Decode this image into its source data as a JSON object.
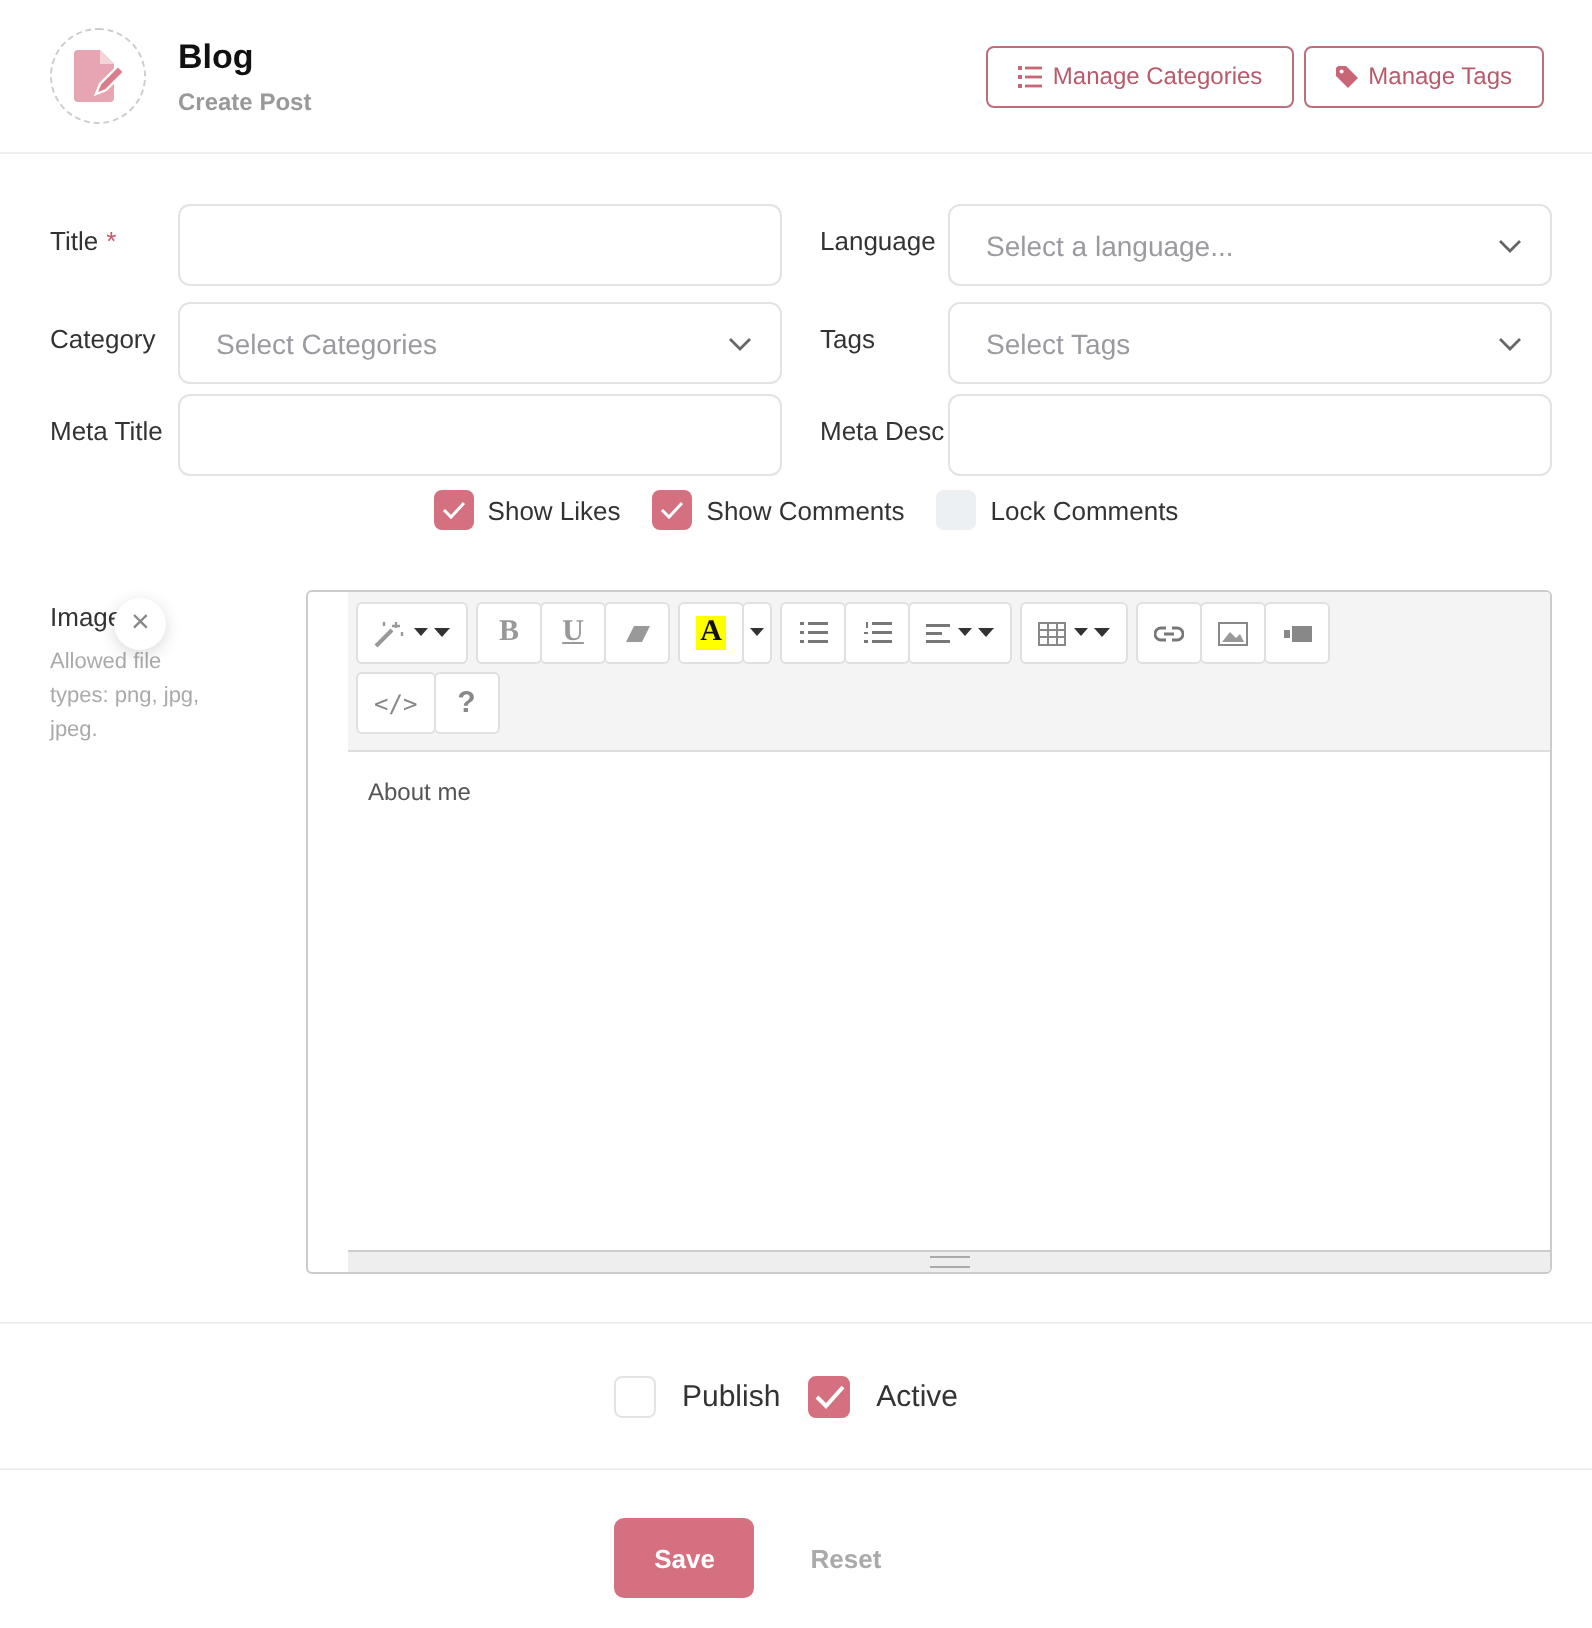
{
  "header": {
    "title": "Blog",
    "subtitle": "Create Post",
    "buttons": [
      {
        "kind": "list",
        "label": "Manage Categories"
      },
      {
        "kind": "tag",
        "label": "Manage Tags"
      }
    ]
  },
  "fields": [
    {
      "label": "Title",
      "required_mark": "*",
      "kind": "text"
    },
    {
      "label": "Language",
      "kind": "select",
      "placeholder": "Select a language..."
    },
    {
      "label": "Category",
      "kind": "select",
      "placeholder": "Select Categories"
    },
    {
      "label": "Tags",
      "kind": "select",
      "placeholder": "Select Tags"
    },
    {
      "label": "Meta Title",
      "kind": "text"
    },
    {
      "label": "Meta Desc",
      "kind": "text"
    }
  ],
  "options": [
    {
      "label": "Show Likes",
      "checked": true
    },
    {
      "label": "Show Comments",
      "checked": true
    },
    {
      "label": "Lock Comments",
      "checked": false
    }
  ],
  "image": {
    "label": "Image",
    "close": "×",
    "hint": "Allowed file types: png, jpg, jpeg."
  },
  "editor": {
    "toolbar": [
      [
        [
          {
            "kind": "magic",
            "caret": true
          }
        ],
        [
          {
            "kind": "bold",
            "label": "B"
          },
          {
            "kind": "underline",
            "label": "U"
          },
          {
            "kind": "eraser"
          }
        ],
        [
          {
            "kind": "color",
            "label": "A",
            "caret": false
          },
          {
            "kind": "more",
            "caret": true
          }
        ],
        [
          {
            "kind": "ul"
          },
          {
            "kind": "ol"
          },
          {
            "kind": "align",
            "caret": true
          }
        ],
        [
          {
            "kind": "table",
            "caret": true
          }
        ],
        [
          {
            "kind": "link"
          },
          {
            "kind": "image"
          },
          {
            "kind": "video"
          }
        ]
      ],
      [
        [
          {
            "kind": "code",
            "label": "</>"
          },
          {
            "kind": "help",
            "label": "?"
          }
        ]
      ]
    ],
    "content": "About me"
  },
  "status": [
    {
      "label": "Publish",
      "checked": false
    },
    {
      "label": "Active",
      "checked": true
    }
  ],
  "actions": {
    "save": "Save",
    "reset": "Reset"
  }
}
